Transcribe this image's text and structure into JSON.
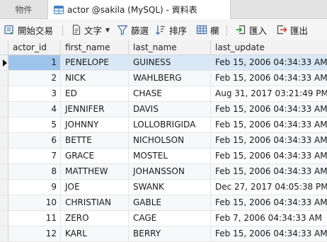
{
  "tabs": {
    "objects_label": "物件",
    "table_label": "actor @sakila (MySQL) - 資料表"
  },
  "toolbar": {
    "begin_transaction": "開始交易",
    "text": "文字",
    "filter": "篩選",
    "sort": "排序",
    "columns": "欄",
    "import": "匯入",
    "export": "匯出"
  },
  "columns": [
    "actor_id",
    "first_name",
    "last_name",
    "last_update"
  ],
  "rows": [
    {
      "actor_id": "1",
      "first_name": "PENELOPE",
      "last_name": "GUINESS",
      "last_update": "Feb 15, 2006 04:34:33 AM"
    },
    {
      "actor_id": "2",
      "first_name": "NICK",
      "last_name": "WAHLBERG",
      "last_update": "Feb 15, 2006 04:34:33 AM"
    },
    {
      "actor_id": "3",
      "first_name": "ED",
      "last_name": "CHASE",
      "last_update": "Aug 31, 2017 03:21:49 PM"
    },
    {
      "actor_id": "4",
      "first_name": "JENNIFER",
      "last_name": "DAVIS",
      "last_update": "Feb 15, 2006 04:34:33 AM"
    },
    {
      "actor_id": "5",
      "first_name": "JOHNNY",
      "last_name": "LOLLOBRIGIDA",
      "last_update": "Feb 15, 2006 04:34:33 AM"
    },
    {
      "actor_id": "6",
      "first_name": "BETTE",
      "last_name": "NICHOLSON",
      "last_update": "Feb 15, 2006 04:34:33 AM"
    },
    {
      "actor_id": "7",
      "first_name": "GRACE",
      "last_name": "MOSTEL",
      "last_update": "Feb 15, 2006 04:34:33 AM"
    },
    {
      "actor_id": "8",
      "first_name": "MATTHEW",
      "last_name": "JOHANSSON",
      "last_update": "Feb 15, 2006 04:34:33 AM"
    },
    {
      "actor_id": "9",
      "first_name": "JOE",
      "last_name": "SWANK",
      "last_update": "Dec 27, 2017 04:05:38 PM"
    },
    {
      "actor_id": "10",
      "first_name": "CHRISTIAN",
      "last_name": "GABLE",
      "last_update": "Feb 15, 2006 04:34:33 AM"
    },
    {
      "actor_id": "11",
      "first_name": "ZERO",
      "last_name": "CAGE",
      "last_update": "Feb 7, 2006 04:34:33 AM"
    },
    {
      "actor_id": "12",
      "first_name": "KARL",
      "last_name": "BERRY",
      "last_update": "Feb 15, 2006 04:34:33 AM"
    }
  ],
  "selected_row": 0,
  "colors": {
    "selected_row": "#d9e7f6",
    "current_cell": "#9fc4ec",
    "header_bg": "#f2f2f2"
  },
  "icons": [
    "table-icon",
    "transaction-icon",
    "text-icon",
    "filter-icon",
    "sort-icon",
    "columns-icon",
    "import-icon",
    "export-icon",
    "row-pointer-icon"
  ]
}
